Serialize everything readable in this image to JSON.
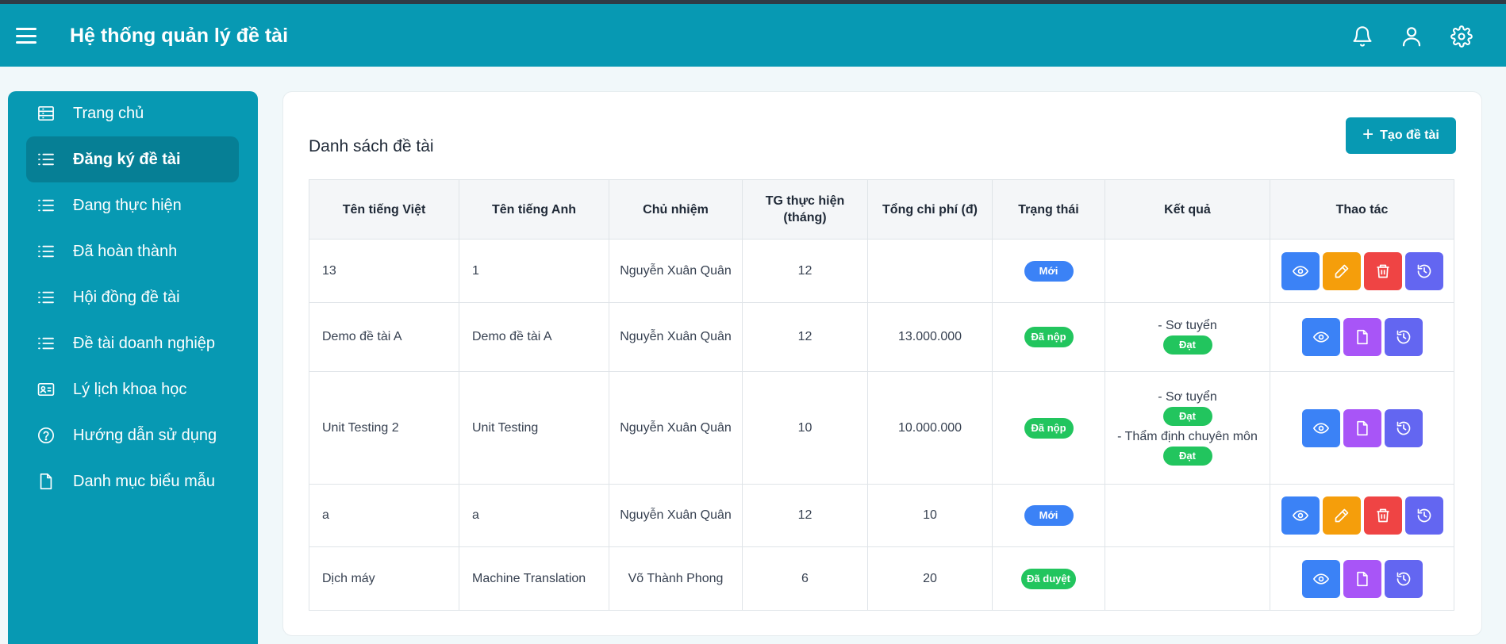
{
  "header": {
    "title": "Hệ thống quản lý đề tài"
  },
  "sidebar": {
    "items": [
      {
        "label": "Trang chủ",
        "icon": "dashboard-icon"
      },
      {
        "label": "Đăng ký đề tài",
        "icon": "list-icon",
        "active": true
      },
      {
        "label": "Đang thực hiện",
        "icon": "list-icon"
      },
      {
        "label": "Đã hoàn thành",
        "icon": "list-icon"
      },
      {
        "label": "Hội đồng đề tài",
        "icon": "list-icon"
      },
      {
        "label": "Đề tài doanh nghiệp",
        "icon": "list-icon"
      },
      {
        "label": "Lý lịch khoa học",
        "icon": "id-card-icon"
      },
      {
        "label": "Hướng dẫn sử dụng",
        "icon": "help-icon"
      },
      {
        "label": "Danh mục biểu mẫu",
        "icon": "file-icon"
      }
    ]
  },
  "main": {
    "title": "Danh sách đề tài",
    "create_button": "Tạo đề tài",
    "columns": [
      "Tên tiếng Việt",
      "Tên tiếng Anh",
      "Chủ nhiệm",
      "TG thực hiện (tháng)",
      "Tổng chi phí (đ)",
      "Trạng thái",
      "Kết quả",
      "Thao tác"
    ],
    "rows": [
      {
        "vi": "13",
        "en": "1",
        "owner": "Nguyễn Xuân Quân",
        "duration": "12",
        "cost": "",
        "status": "Mới",
        "results": [],
        "actions": [
          "view",
          "edit",
          "delete",
          "history"
        ]
      },
      {
        "vi": "Demo đề tài A",
        "en": "Demo đề tài A",
        "owner": "Nguyễn Xuân Quân",
        "duration": "12",
        "cost": "13.000.000",
        "status": "Đã nộp",
        "results": [
          {
            "label": "- Sơ tuyển",
            "value": "Đạt"
          }
        ],
        "actions": [
          "view",
          "document",
          "history"
        ]
      },
      {
        "vi": "Unit Testing 2",
        "en": "Unit Testing",
        "owner": "Nguyễn Xuân Quân",
        "duration": "10",
        "cost": "10.000.000",
        "status": "Đã nộp",
        "results": [
          {
            "label": "- Sơ tuyển",
            "value": "Đạt"
          },
          {
            "label": "- Thẩm định chuyên môn",
            "value": "Đạt"
          }
        ],
        "actions": [
          "view",
          "document",
          "history"
        ]
      },
      {
        "vi": "a",
        "en": "a",
        "owner": "Nguyễn Xuân Quân",
        "duration": "12",
        "cost": "10",
        "status": "Mới",
        "results": [],
        "actions": [
          "view",
          "edit",
          "delete",
          "history"
        ]
      },
      {
        "vi": "Dịch máy",
        "en": "Machine Translation",
        "owner": "Võ Thành Phong",
        "duration": "6",
        "cost": "20",
        "status": "Đã duyệt",
        "results": [],
        "actions": [
          "view",
          "document",
          "history"
        ]
      }
    ]
  },
  "colors": {
    "primary": "#0799b3",
    "status_new": "#3b82f6",
    "status_done": "#22c55e",
    "view": "#3b82f6",
    "edit": "#f59e0b",
    "delete": "#ef4444",
    "document": "#a855f7",
    "history": "#6366f1"
  }
}
